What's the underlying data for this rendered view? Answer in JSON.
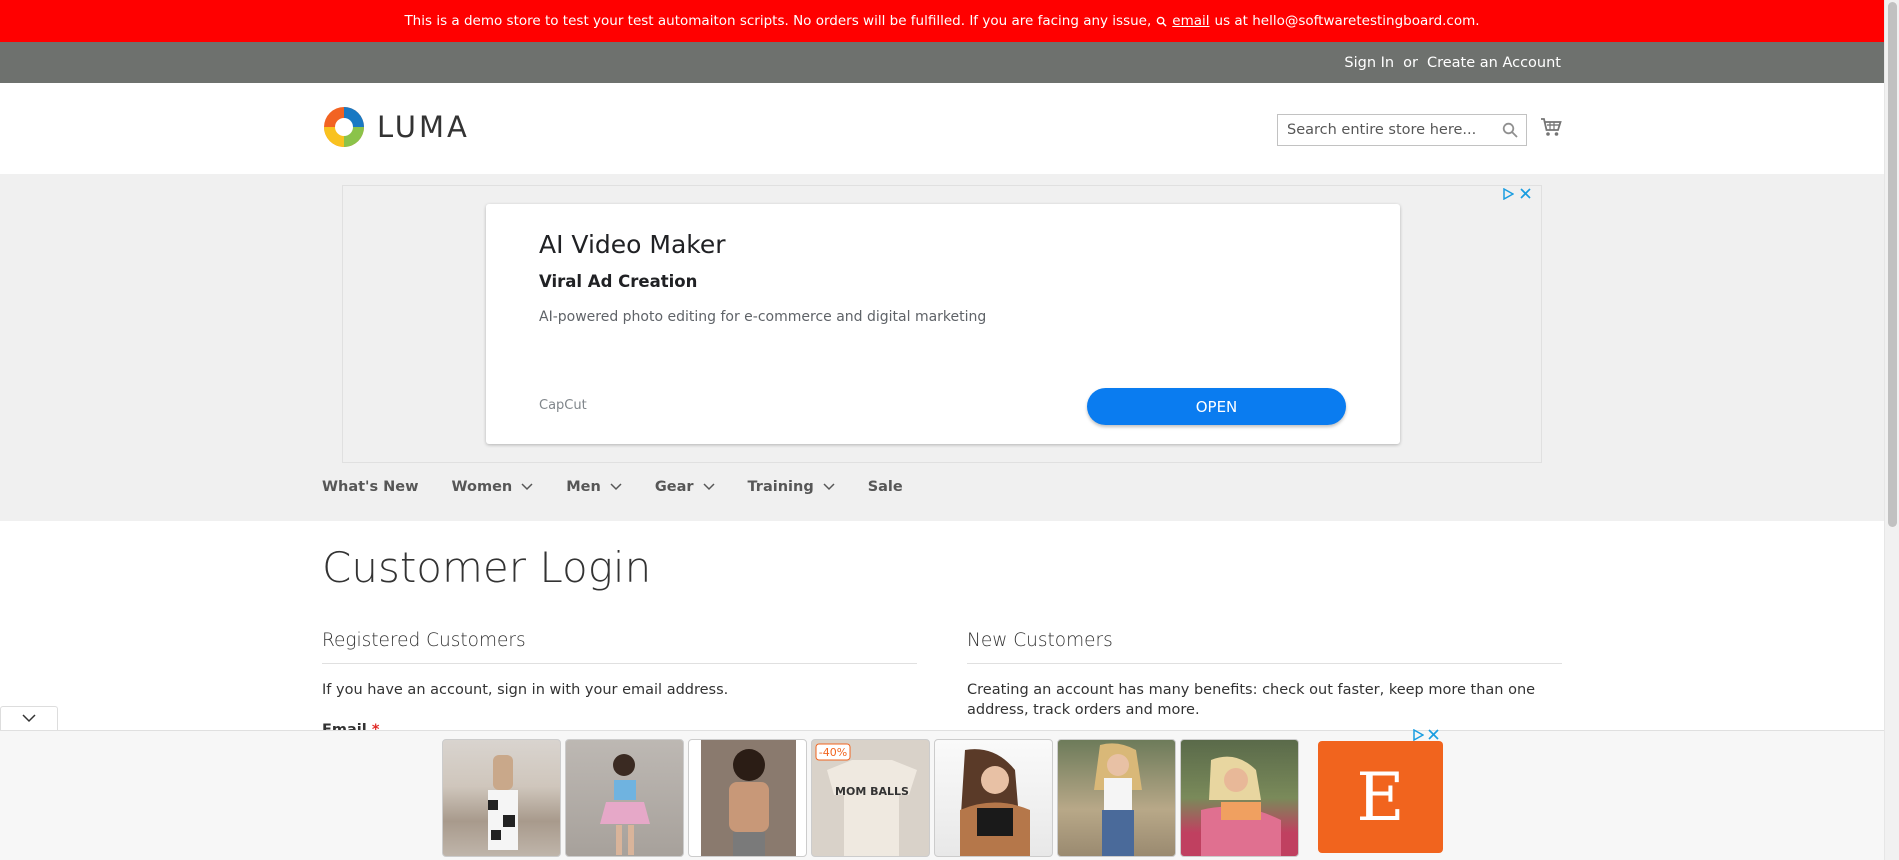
{
  "banner": {
    "text": "This is a demo store to test your test automaiton scripts. No orders will be fulfilled. If you are facing any issue,",
    "link": "email",
    "text_after": "us at hello@softwaretestingboard.com."
  },
  "header": {
    "sign_in": "Sign In",
    "or": "or",
    "create_account": "Create an Account",
    "logo_text": "LUMA",
    "search_placeholder": "Search entire store here..."
  },
  "ad": {
    "title": "AI Video Maker",
    "subtitle": "Viral Ad Creation",
    "description": "AI-powered photo editing for e-commerce and digital marketing",
    "brand": "CapCut",
    "cta": "OPEN"
  },
  "nav": {
    "items": [
      {
        "label": "What's New",
        "dropdown": false
      },
      {
        "label": "Women",
        "dropdown": true
      },
      {
        "label": "Men",
        "dropdown": true
      },
      {
        "label": "Gear",
        "dropdown": true
      },
      {
        "label": "Training",
        "dropdown": true
      },
      {
        "label": "Sale",
        "dropdown": false
      }
    ]
  },
  "main": {
    "title": "Customer Login",
    "registered_title": "Registered Customers",
    "registered_text": "If you have an account, sign in with your email address.",
    "email_label": "Email",
    "required_mark": "*",
    "new_title": "New Customers",
    "new_text": "Creating an account has many benefits: check out faster, keep more than one address, track orders and more."
  },
  "bottom_ad": {
    "badge": "-40%",
    "shirt_text": "MOM BALLS",
    "etsy_letter": "E"
  },
  "colors": {
    "banner": "#ff0000",
    "panel": "#6e716e",
    "ad_button": "#0a7cf0",
    "etsy": "#f1641e"
  }
}
